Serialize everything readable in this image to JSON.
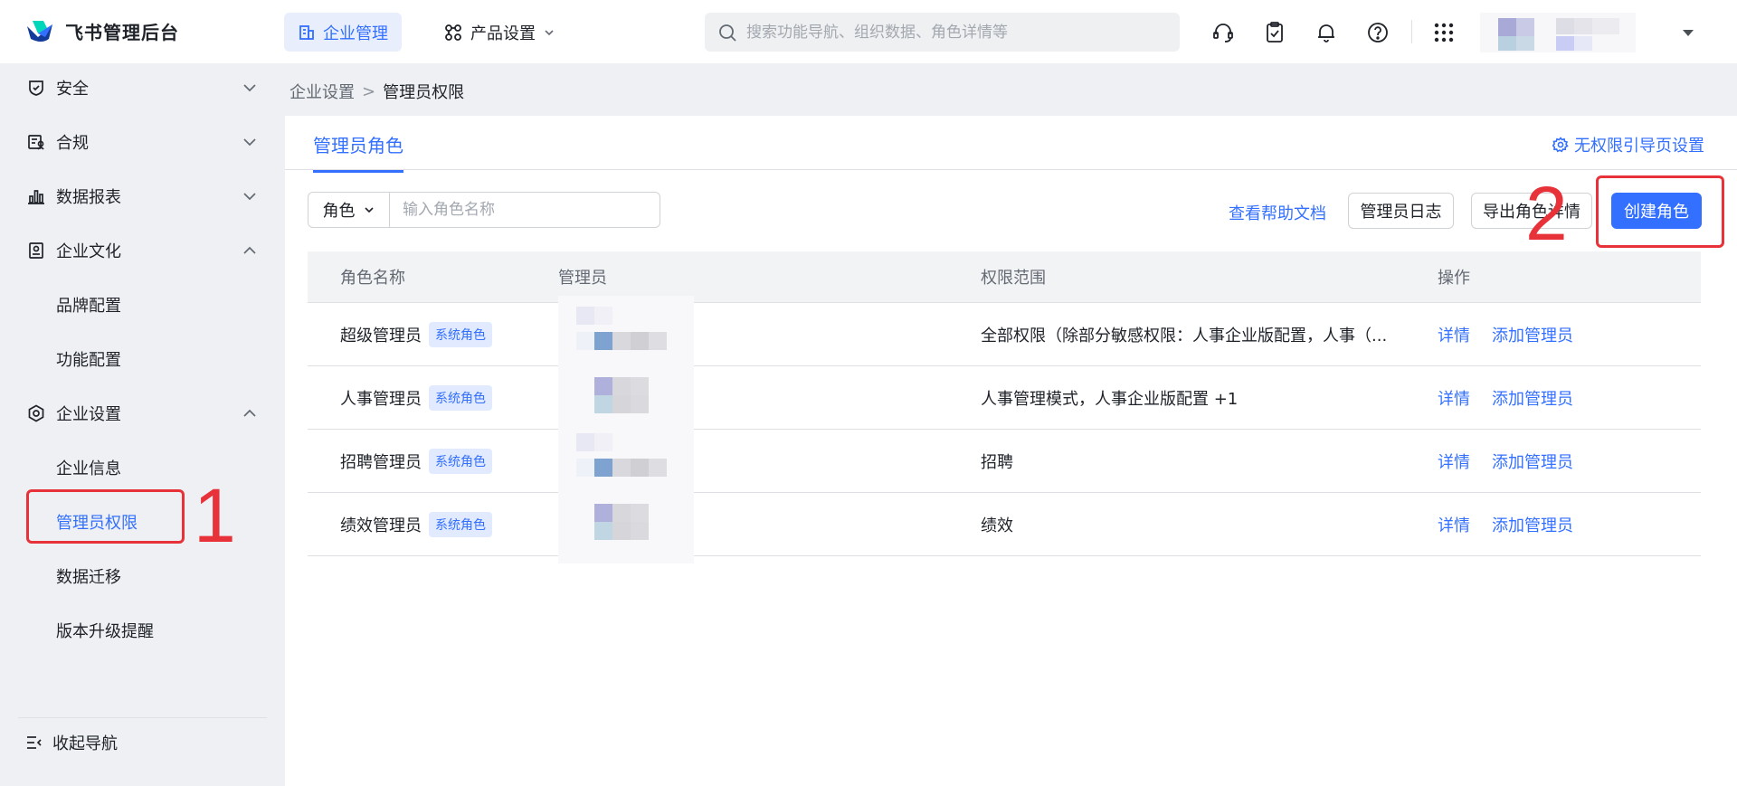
{
  "header": {
    "brand": "飞书管理后台",
    "nav_enterprise": "企业管理",
    "nav_product": "产品设置",
    "search_placeholder": "搜索功能导航、组织数据、角色详情等"
  },
  "icons": {
    "headset": "headset-icon",
    "clipboard": "clipboard-check-icon",
    "bell": "bell-icon",
    "help": "question-circle-icon",
    "apps": "grid-icon"
  },
  "sidebar": {
    "security": "安全",
    "compliance": "合规",
    "reports": "数据报表",
    "culture": "企业文化",
    "culture_items": [
      "品牌配置",
      "功能配置"
    ],
    "settings": "企业设置",
    "settings_items": [
      "企业信息",
      "管理员权限",
      "数据迁移",
      "版本升级提醒"
    ],
    "collapse": "收起导航"
  },
  "breadcrumb": {
    "parent": "企业设置",
    "sep": ">",
    "current": "管理员权限"
  },
  "tab_active": "管理员角色",
  "top_right_link": "无权限引导页设置",
  "filter": {
    "select": "角色",
    "placeholder": "输入角色名称"
  },
  "toolbar": {
    "help": "查看帮助文档",
    "log": "管理员日志",
    "export": "导出角色详情",
    "create": "创建角色"
  },
  "annotations": {
    "one": "1",
    "two": "2"
  },
  "table": {
    "columns": [
      "角色名称",
      "管理员",
      "权限范围",
      "操作"
    ],
    "rows": [
      {
        "name": "超级管理员",
        "tag": "系统角色",
        "scope": "全部权限（除部分敏感权限：人事企业版配置，人事（...",
        "op1": "详情",
        "op2": "添加管理员"
      },
      {
        "name": "人事管理员",
        "tag": "系统角色",
        "scope": "人事管理模式，人事企业版配置 +1",
        "op1": "详情",
        "op2": "添加管理员"
      },
      {
        "name": "招聘管理员",
        "tag": "系统角色",
        "scope": "招聘",
        "op1": "详情",
        "op2": "添加管理员"
      },
      {
        "name": "绩效管理员",
        "tag": "系统角色",
        "scope": "绩效",
        "op1": "详情",
        "op2": "添加管理员"
      }
    ]
  },
  "colors": {
    "accent": "#3370ff",
    "annotation": "#e8323a",
    "tag_bg": "#e1eaff"
  }
}
